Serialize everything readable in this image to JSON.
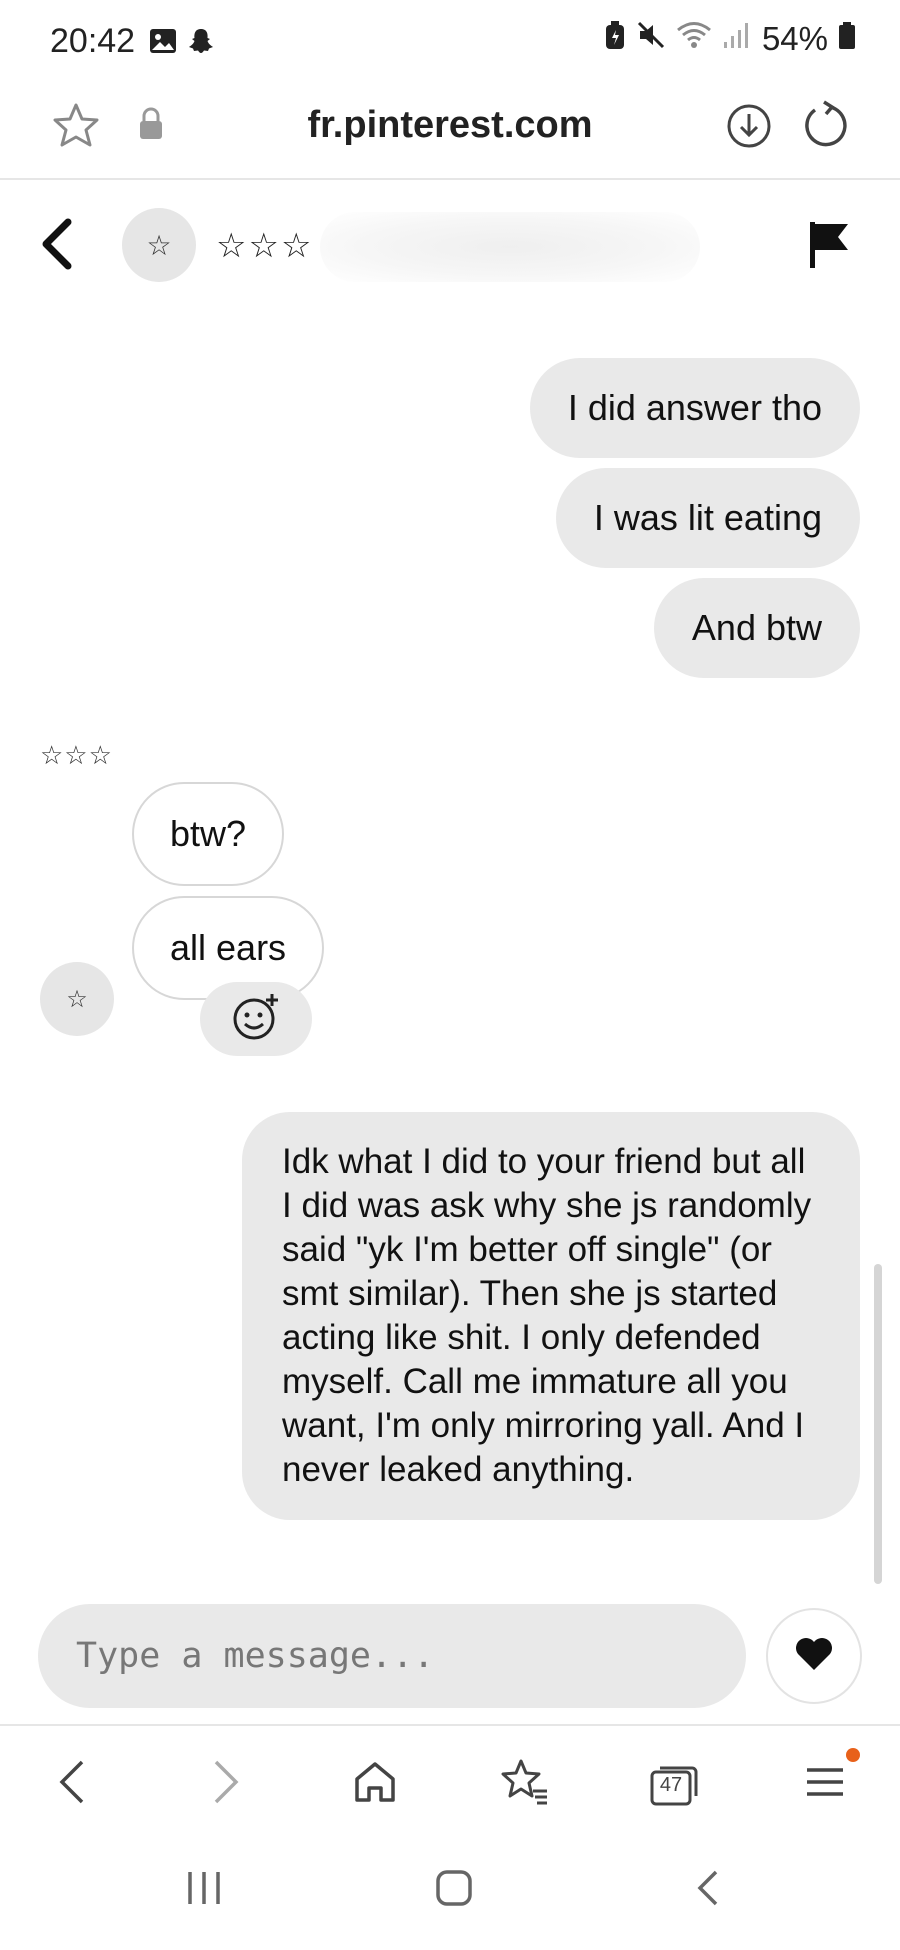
{
  "status_bar": {
    "time": "20:42",
    "battery": "54%",
    "icons": [
      "gallery-icon",
      "snapchat-icon",
      "battery-saver-icon",
      "mute-icon",
      "wifi-icon",
      "signal-icon",
      "battery-icon"
    ]
  },
  "browser": {
    "url": "fr.pinterest.com",
    "icons": [
      "bookmark-star-icon",
      "lock-icon",
      "download-icon",
      "reload-icon"
    ]
  },
  "chat": {
    "contact_name": "☆☆☆",
    "contact_avatar": "☆",
    "messages_sent_top": [
      "I did answer tho",
      "I was lit eating",
      "And btw"
    ],
    "sender_label": "☆☆☆",
    "messages_received": [
      "btw?",
      "all ears"
    ],
    "received_avatar": "☆",
    "message_sent_long": "Idk what I did to your friend but all I did was ask why she js randomly said \"yk I'm better off single\" (or smt similar). Then she js started acting like shit. I only defended myself. Call me immature all you want, I'm only mirroring yall. And I never leaked anything."
  },
  "composer": {
    "placeholder": "Type a message...",
    "value": ""
  },
  "browser_nav": {
    "tab_count": "47"
  },
  "colors": {
    "sent_bubble": "#e9e9e9",
    "received_border": "#d7d7d7",
    "notification_dot": "#e8611a"
  }
}
